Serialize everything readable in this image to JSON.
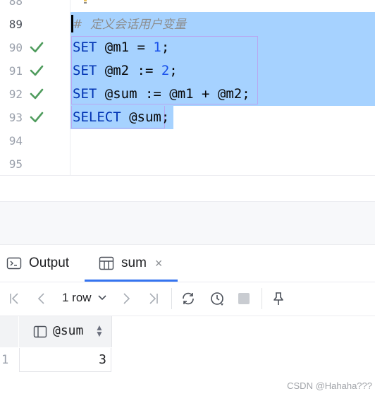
{
  "editor": {
    "line_numbers": [
      "88",
      "89",
      "90",
      "91",
      "92",
      "93",
      "94",
      "95"
    ],
    "comment": "#  定义会话用户变量",
    "lines": [
      {
        "kw": "SET",
        "rest_a": " @m1 = ",
        "num": "1",
        "rest_b": ";"
      },
      {
        "kw": "SET",
        "rest_a": " @m2 := ",
        "num": "2",
        "rest_b": ";"
      },
      {
        "kw": "SET",
        "rest_a": " @sum := @m1 + @m2;",
        "num": "",
        "rest_b": ""
      },
      {
        "kw": "SELECT",
        "rest_a": " @sum",
        "num": "",
        "rest_b": ";"
      }
    ],
    "colors": {
      "selection": "#a6d2ff",
      "keyword": "#0033b3",
      "number": "#1750eb",
      "check": "#4f9c5d"
    }
  },
  "tabs": {
    "output_label": "Output",
    "result_label": "sum",
    "close_glyph": "×"
  },
  "toolbar": {
    "rows_label": "1 row",
    "icons": [
      "first-page-icon",
      "previous-page-icon",
      "next-page-icon",
      "last-page-icon",
      "refresh-icon",
      "history-icon",
      "stop-icon",
      "pin-icon"
    ]
  },
  "grid": {
    "column": "@sum",
    "rows": [
      {
        "num": "1",
        "value": "3"
      }
    ]
  },
  "watermark": "CSDN @Hahaha???"
}
